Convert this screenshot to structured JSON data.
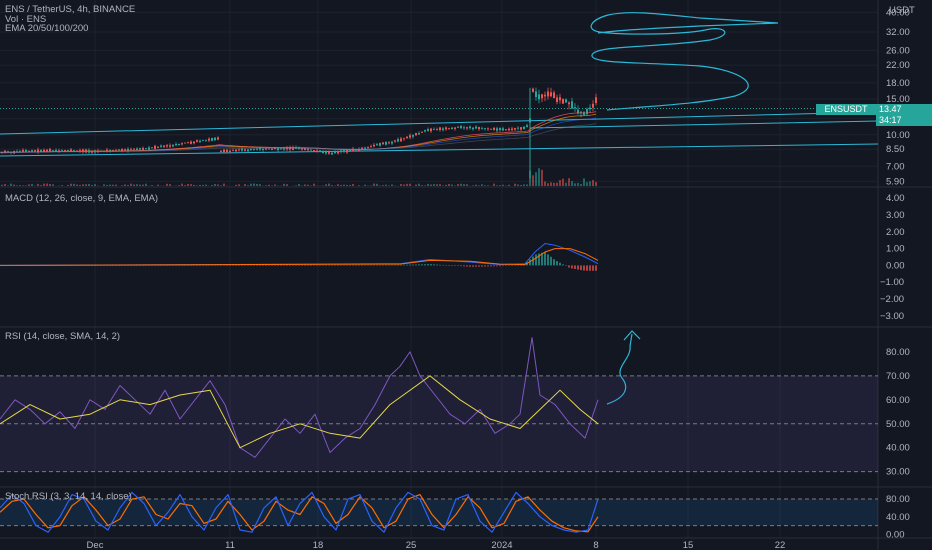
{
  "header": {
    "title": "ENS / TetherUS, 4h, BINANCE",
    "vol": "Vol · ENS",
    "ema": "EMA 20/50/100/200"
  },
  "currency": "USDT",
  "last_price": "13.47",
  "countdown": "34:17",
  "symbol_badge": "ENSUSDT",
  "colors": {
    "background": "#131722",
    "up": "#26a69a",
    "down": "#ef5350",
    "drawing": "#2bb8d6",
    "rsi": "#7e57c2",
    "rsi_ma": "#e8d84a",
    "macd": "#2962ff",
    "signal": "#ff6d00",
    "stoch_k": "#2962ff",
    "stoch_d": "#ff6d00"
  },
  "chart_data": [
    {
      "type": "line",
      "panel": "price",
      "scale": "log",
      "x_ticks": [
        "Dec",
        "11",
        "18",
        "25",
        "2024",
        "8",
        "15",
        "22"
      ],
      "y_ticks": [
        5.9,
        7.0,
        8.5,
        10.0,
        12.0,
        15.0,
        18.0,
        22.0,
        26.0,
        32.0,
        40.0
      ],
      "last_value": 13.47,
      "series": [
        {
          "x": [
            0,
            50,
            100,
            150,
            200,
            220,
            221,
            260,
            300,
            330,
            360,
            400,
            430,
            460,
            500,
            525,
            530,
            532,
            540,
            550,
            570,
            585,
            595
          ],
          "values": [
            8.2,
            8.4,
            8.3,
            8.6,
            9.3,
            9.6,
            8.3,
            8.5,
            8.6,
            8.1,
            8.5,
            9.4,
            10.6,
            10.9,
            10.6,
            10.8,
            11.6,
            16.5,
            15.2,
            15.8,
            14.2,
            12.5,
            14.6
          ]
        }
      ]
    },
    {
      "type": "line",
      "panel": "macd",
      "title": "MACD (12, 26, close, 9, EMA, EMA)",
      "y_ticks": [
        4.0,
        3.0,
        2.0,
        1.0,
        0.0,
        -1.0,
        -2.0,
        -3.0
      ],
      "series": [
        {
          "x": [
            0,
            200,
            400,
            430,
            470,
            500,
            525,
            535,
            545,
            555,
            570,
            585,
            598
          ],
          "values": [
            0.0,
            0.05,
            0.1,
            0.35,
            0.2,
            0.05,
            0.1,
            0.8,
            1.3,
            1.2,
            0.9,
            0.5,
            0.1
          ]
        },
        {
          "x": [
            0,
            200,
            400,
            430,
            470,
            500,
            525,
            535,
            545,
            555,
            570,
            585,
            598
          ],
          "values": [
            0.0,
            0.04,
            0.08,
            0.3,
            0.25,
            0.08,
            0.05,
            0.4,
            0.8,
            1.0,
            1.0,
            0.7,
            0.3
          ]
        }
      ]
    },
    {
      "type": "line",
      "panel": "rsi",
      "title": "RSI (14, close, SMA, 14, 2)",
      "y_ticks": [
        80.0,
        70.0,
        60.0,
        50.0,
        40.0,
        30.0
      ],
      "bands": [
        70,
        50,
        30
      ],
      "series": [
        {
          "x": [
            0,
            15,
            30,
            45,
            60,
            75,
            90,
            105,
            120,
            135,
            150,
            165,
            180,
            195,
            210,
            225,
            240,
            255,
            270,
            285,
            300,
            315,
            330,
            345,
            360,
            375,
            390,
            400,
            410,
            420,
            435,
            450,
            465,
            480,
            495,
            510,
            520,
            532,
            540,
            555,
            570,
            585,
            598
          ],
          "values": [
            52,
            60,
            56,
            50,
            55,
            48,
            60,
            56,
            66,
            60,
            54,
            64,
            52,
            60,
            68,
            58,
            40,
            36,
            44,
            52,
            46,
            54,
            38,
            44,
            48,
            58,
            70,
            74,
            80,
            70,
            62,
            54,
            50,
            56,
            46,
            50,
            54,
            86,
            62,
            58,
            50,
            44,
            60
          ]
        },
        {
          "x": [
            0,
            30,
            60,
            90,
            120,
            150,
            180,
            210,
            240,
            270,
            300,
            330,
            360,
            390,
            430,
            460,
            490,
            520,
            540,
            560,
            580,
            598
          ],
          "values": [
            50,
            58,
            52,
            54,
            60,
            58,
            62,
            64,
            40,
            46,
            50,
            46,
            44,
            58,
            70,
            60,
            52,
            48,
            56,
            64,
            56,
            50
          ]
        }
      ]
    },
    {
      "type": "line",
      "panel": "stoch_rsi",
      "title": "Stoch RSI (3, 3, 14, 14, close)",
      "y_ticks": [
        80.0,
        40.0,
        0.0
      ],
      "bands": [
        80,
        20
      ],
      "series": [
        {
          "x": [
            0,
            12,
            24,
            36,
            48,
            60,
            72,
            84,
            96,
            108,
            120,
            132,
            144,
            156,
            168,
            180,
            192,
            204,
            216,
            228,
            240,
            252,
            264,
            276,
            288,
            300,
            312,
            324,
            336,
            348,
            360,
            372,
            384,
            396,
            408,
            420,
            432,
            444,
            456,
            468,
            480,
            492,
            504,
            516,
            528,
            540,
            552,
            564,
            576,
            588,
            598
          ],
          "values": [
            60,
            90,
            70,
            20,
            5,
            40,
            90,
            80,
            30,
            10,
            60,
            95,
            70,
            20,
            50,
            90,
            40,
            10,
            60,
            90,
            10,
            5,
            60,
            85,
            20,
            70,
            95,
            40,
            10,
            80,
            90,
            30,
            5,
            60,
            95,
            80,
            20,
            10,
            80,
            90,
            30,
            5,
            50,
            95,
            70,
            40,
            20,
            10,
            5,
            10,
            80
          ]
        },
        {
          "x": [
            0,
            12,
            24,
            36,
            48,
            60,
            72,
            84,
            96,
            108,
            120,
            132,
            144,
            156,
            168,
            180,
            192,
            204,
            216,
            228,
            240,
            252,
            264,
            276,
            288,
            300,
            312,
            324,
            336,
            348,
            360,
            372,
            384,
            396,
            408,
            420,
            432,
            444,
            456,
            468,
            480,
            492,
            504,
            516,
            528,
            540,
            552,
            564,
            576,
            588,
            598
          ],
          "values": [
            50,
            75,
            80,
            45,
            15,
            20,
            65,
            85,
            55,
            20,
            35,
            80,
            85,
            45,
            35,
            70,
            65,
            25,
            35,
            75,
            45,
            10,
            30,
            75,
            55,
            45,
            85,
            70,
            25,
            45,
            85,
            60,
            15,
            30,
            80,
            90,
            45,
            15,
            45,
            85,
            60,
            15,
            25,
            75,
            85,
            55,
            30,
            15,
            8,
            6,
            40
          ]
        }
      ]
    }
  ]
}
